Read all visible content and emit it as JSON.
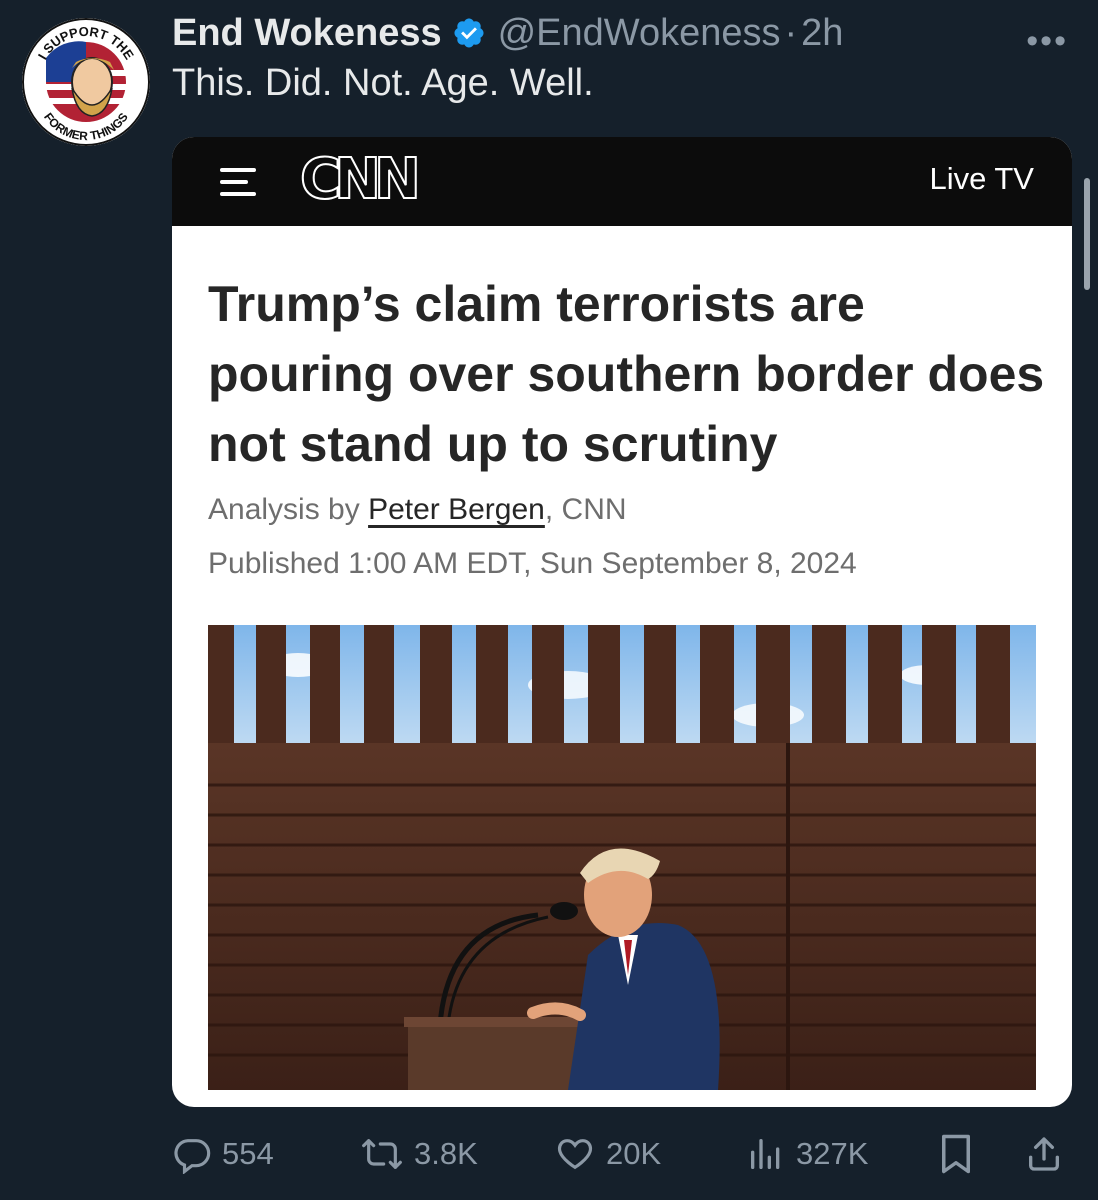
{
  "tweet": {
    "display_name": "End Wokeness",
    "handle": "@EndWokeness",
    "separator": "·",
    "time_ago": "2h",
    "text": "This. Did. Not. Age. Well.",
    "more_label": "•••",
    "avatar": {
      "top_text": "I SUPPORT THE",
      "bottom_text": "FORMER THINGS"
    }
  },
  "embedded_article": {
    "site_bar": {
      "logo": "CNN",
      "live_tv": "Live TV"
    },
    "headline": "Trump’s claim terrorists are pouring over southern border does not stand up to scrutiny",
    "byline_prefix": "Analysis by ",
    "author": "Peter Bergen",
    "byline_suffix": ", CNN",
    "published": "Published 1:00 AM EDT, Sun September 8, 2024"
  },
  "actions": {
    "replies": "554",
    "reposts": "3.8K",
    "likes": "20K",
    "views": "327K"
  },
  "colors": {
    "background": "#15202b",
    "verified": "#1d9bf0",
    "muted": "#8b98a5",
    "primary_text": "#e7e9ea"
  }
}
